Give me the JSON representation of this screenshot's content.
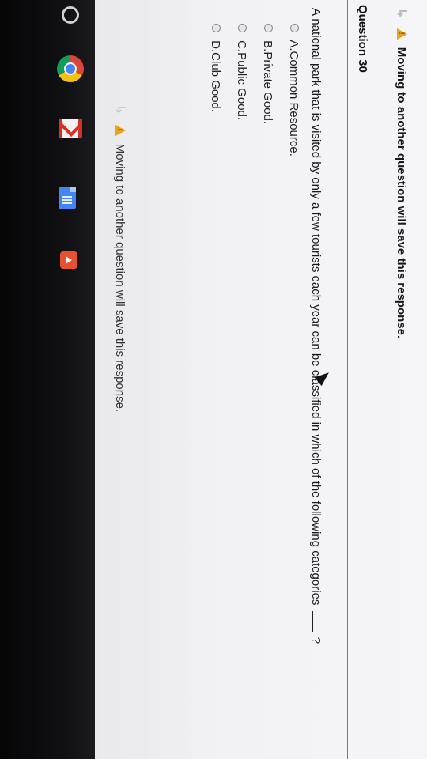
{
  "warning": {
    "icon": "warning-icon",
    "text": "Moving to another question will save this response."
  },
  "question": {
    "title": "Question 30",
    "text_before": "A national park that is visited by only a few tourists each year can be classified in which of the following categories",
    "text_after": "?"
  },
  "options": [
    {
      "label": "A.Common Resource."
    },
    {
      "label": "B.Private Good."
    },
    {
      "label": "C.Public Good."
    },
    {
      "label": "D.Club Good."
    }
  ],
  "shelf": {
    "icons": [
      "launcher-icon",
      "chrome-icon",
      "gmail-icon",
      "docs-icon",
      "youtube-icon"
    ]
  }
}
